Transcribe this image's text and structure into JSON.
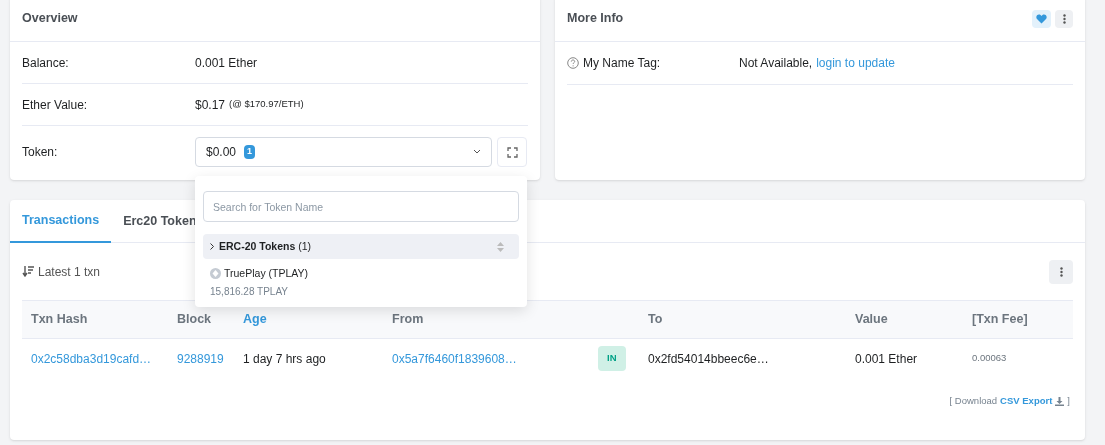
{
  "overview": {
    "title": "Overview",
    "rows": [
      {
        "label": "Balance:",
        "value": "0.001 Ether"
      },
      {
        "label": "Ether Value:",
        "value": "$0.17",
        "note": "(@ $170.97/ETH)"
      }
    ],
    "token": {
      "label": "Token:",
      "value": "$0.00",
      "count": "1",
      "expanded": true
    }
  },
  "token_dropdown": {
    "search": {
      "placeholder": "Search for Token Name"
    },
    "group": {
      "title": "ERC-20 Tokens",
      "count": "(1)"
    },
    "items": [
      {
        "name": "TruePlay (TPLAY)",
        "amount": "15,816.28 TPLAY"
      }
    ]
  },
  "more_info": {
    "title": "More Info",
    "rows": [
      {
        "label": "My Name Tag:",
        "value": "Not Available,",
        "link": "login to update"
      }
    ]
  },
  "tabs": [
    {
      "label": "Transactions",
      "selected": true
    },
    {
      "label": "Erc20 Token",
      "selected": false
    }
  ],
  "summary": "Latest 1 txn",
  "table": {
    "columns": [
      {
        "label": "Txn Hash",
        "sortable": false
      },
      {
        "label": "Block",
        "sortable": false
      },
      {
        "label": "Age",
        "sortable": true
      },
      {
        "label": "From",
        "sortable": false
      },
      {
        "label": "To",
        "sortable": false
      },
      {
        "label": "Value",
        "sortable": false
      },
      {
        "label": "[Txn Fee]",
        "sortable": false
      }
    ],
    "rows": [
      {
        "hash": "0x2c58dba3d19cafd…",
        "block": "9288919",
        "age": "1 day 7 hrs ago",
        "from": "0x5a7f6460f1839608…",
        "direction": "IN",
        "to": "0x2fd54014bbeec6e…",
        "value": "0.001 Ether",
        "fee": "0.00063"
      }
    ]
  },
  "export": {
    "prefix": "[ Download",
    "link": "CSV Export",
    "suffix": "]"
  }
}
